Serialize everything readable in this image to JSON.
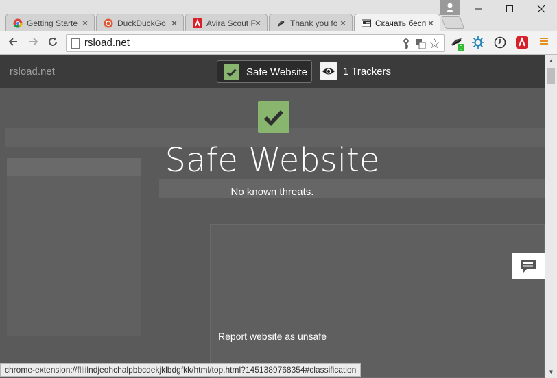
{
  "tabs": [
    {
      "label": "Getting Starte",
      "icon": "chrome-icon"
    },
    {
      "label": "DuckDuckGo",
      "icon": "duckduckgo-icon"
    },
    {
      "label": "Avira Scout F",
      "icon": "avira-icon"
    },
    {
      "label": "Thank you fo",
      "icon": "ghostery-icon"
    },
    {
      "label": "Скачать бесп",
      "icon": "rsload-icon",
      "active": true
    }
  ],
  "toolbar": {
    "url": "rsload.net",
    "ghostery_badge": "0"
  },
  "overlay": {
    "site_host": "rsload.net",
    "safe_pill_label": "Safe Website",
    "trackers_label": "1 Trackers",
    "headline": "Safe Website",
    "subline": "No known threats.",
    "report_link": "Report website as unsafe"
  },
  "status": {
    "text": "chrome-extension://flliilndjeohchalpbbcdekjklbdgfkk/html/top.html?1451389768354#classification"
  },
  "colors": {
    "safe_green": "#88b66e",
    "overlay_dark": "#3b3b3b"
  }
}
